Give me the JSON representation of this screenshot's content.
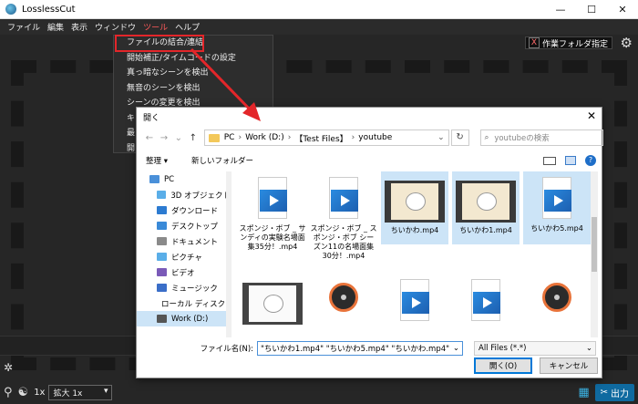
{
  "window": {
    "title": "LosslessCut",
    "controls": [
      "—",
      "☐",
      "✕"
    ]
  },
  "menubar": [
    "ファイル",
    "編集",
    "表示",
    "ウィンドウ",
    "ツール",
    "ヘルプ"
  ],
  "tools_menu": {
    "items": [
      "ファイルの結合/連結",
      "開始補正/タイムコードの設定",
      "真っ暗なシーンを検出",
      "無音のシーンを検出",
      "シーンの変更を検出",
      "キ",
      "最",
      "開"
    ]
  },
  "header": {
    "folder_button_x": "X",
    "folder_button_label": "作業フォルダ指定"
  },
  "bottombar": {
    "zoom_prefix": "1x",
    "zoom_select": "拡大 1x",
    "export_label": "出力"
  },
  "dialog": {
    "title": "開く",
    "breadcrumb": [
      "PC",
      "Work (D:)",
      "【Test Files】",
      "youtube"
    ],
    "search_placeholder": "youtubeの検索",
    "toolbar": {
      "organize": "整理 ▾",
      "new_folder": "新しいフォルダー"
    },
    "nav": [
      {
        "label": "PC",
        "color": "#4a90d9"
      },
      {
        "label": "3D オブジェクト",
        "color": "#5aaee8"
      },
      {
        "label": "ダウンロード",
        "color": "#2c7bd1"
      },
      {
        "label": "デスクトップ",
        "color": "#3a8ad8"
      },
      {
        "label": "ドキュメント",
        "color": "#8a8a8a"
      },
      {
        "label": "ピクチャ",
        "color": "#5aaee8"
      },
      {
        "label": "ビデオ",
        "color": "#7a5ab8"
      },
      {
        "label": "ミュージック",
        "color": "#3a6ec8"
      },
      {
        "label": "ローカル ディスク (C",
        "color": "#888"
      },
      {
        "label": "Work (D:)",
        "color": "#555"
      }
    ],
    "files": [
      {
        "name": "スポンジ・ボブ _ サンディの実験名場面集35分！.mp4",
        "kind": "doc",
        "selected": false
      },
      {
        "name": "スポンジ・ボブ _ スポンジ・ボブ シーズン11の名場面集30分！.mp4",
        "kind": "doc",
        "selected": false
      },
      {
        "name": "ちいかわ.mp4",
        "kind": "video",
        "selected": true
      },
      {
        "name": "ちいかわ1.mp4",
        "kind": "video",
        "selected": true
      },
      {
        "name": "ちいかわ5.mp4",
        "kind": "doc",
        "selected": true
      },
      {
        "name": "",
        "kind": "video2",
        "selected": false
      },
      {
        "name": "",
        "kind": "disc",
        "selected": false
      },
      {
        "name": "",
        "kind": "doc",
        "selected": false
      },
      {
        "name": "",
        "kind": "doc",
        "selected": false
      },
      {
        "name": "",
        "kind": "disc",
        "selected": false
      }
    ],
    "filename_label": "ファイル名(N):",
    "filename_value": "\"ちいかわ1.mp4\" \"ちいかわ5.mp4\" \"ちいかわ.mp4\"",
    "filetype_value": "All Files (*.*)",
    "open_button": "開く(O)",
    "cancel_button": "キャンセル"
  },
  "colors": {
    "highlight_red": "#e3262a",
    "accent_blue": "#0f6aa0"
  }
}
